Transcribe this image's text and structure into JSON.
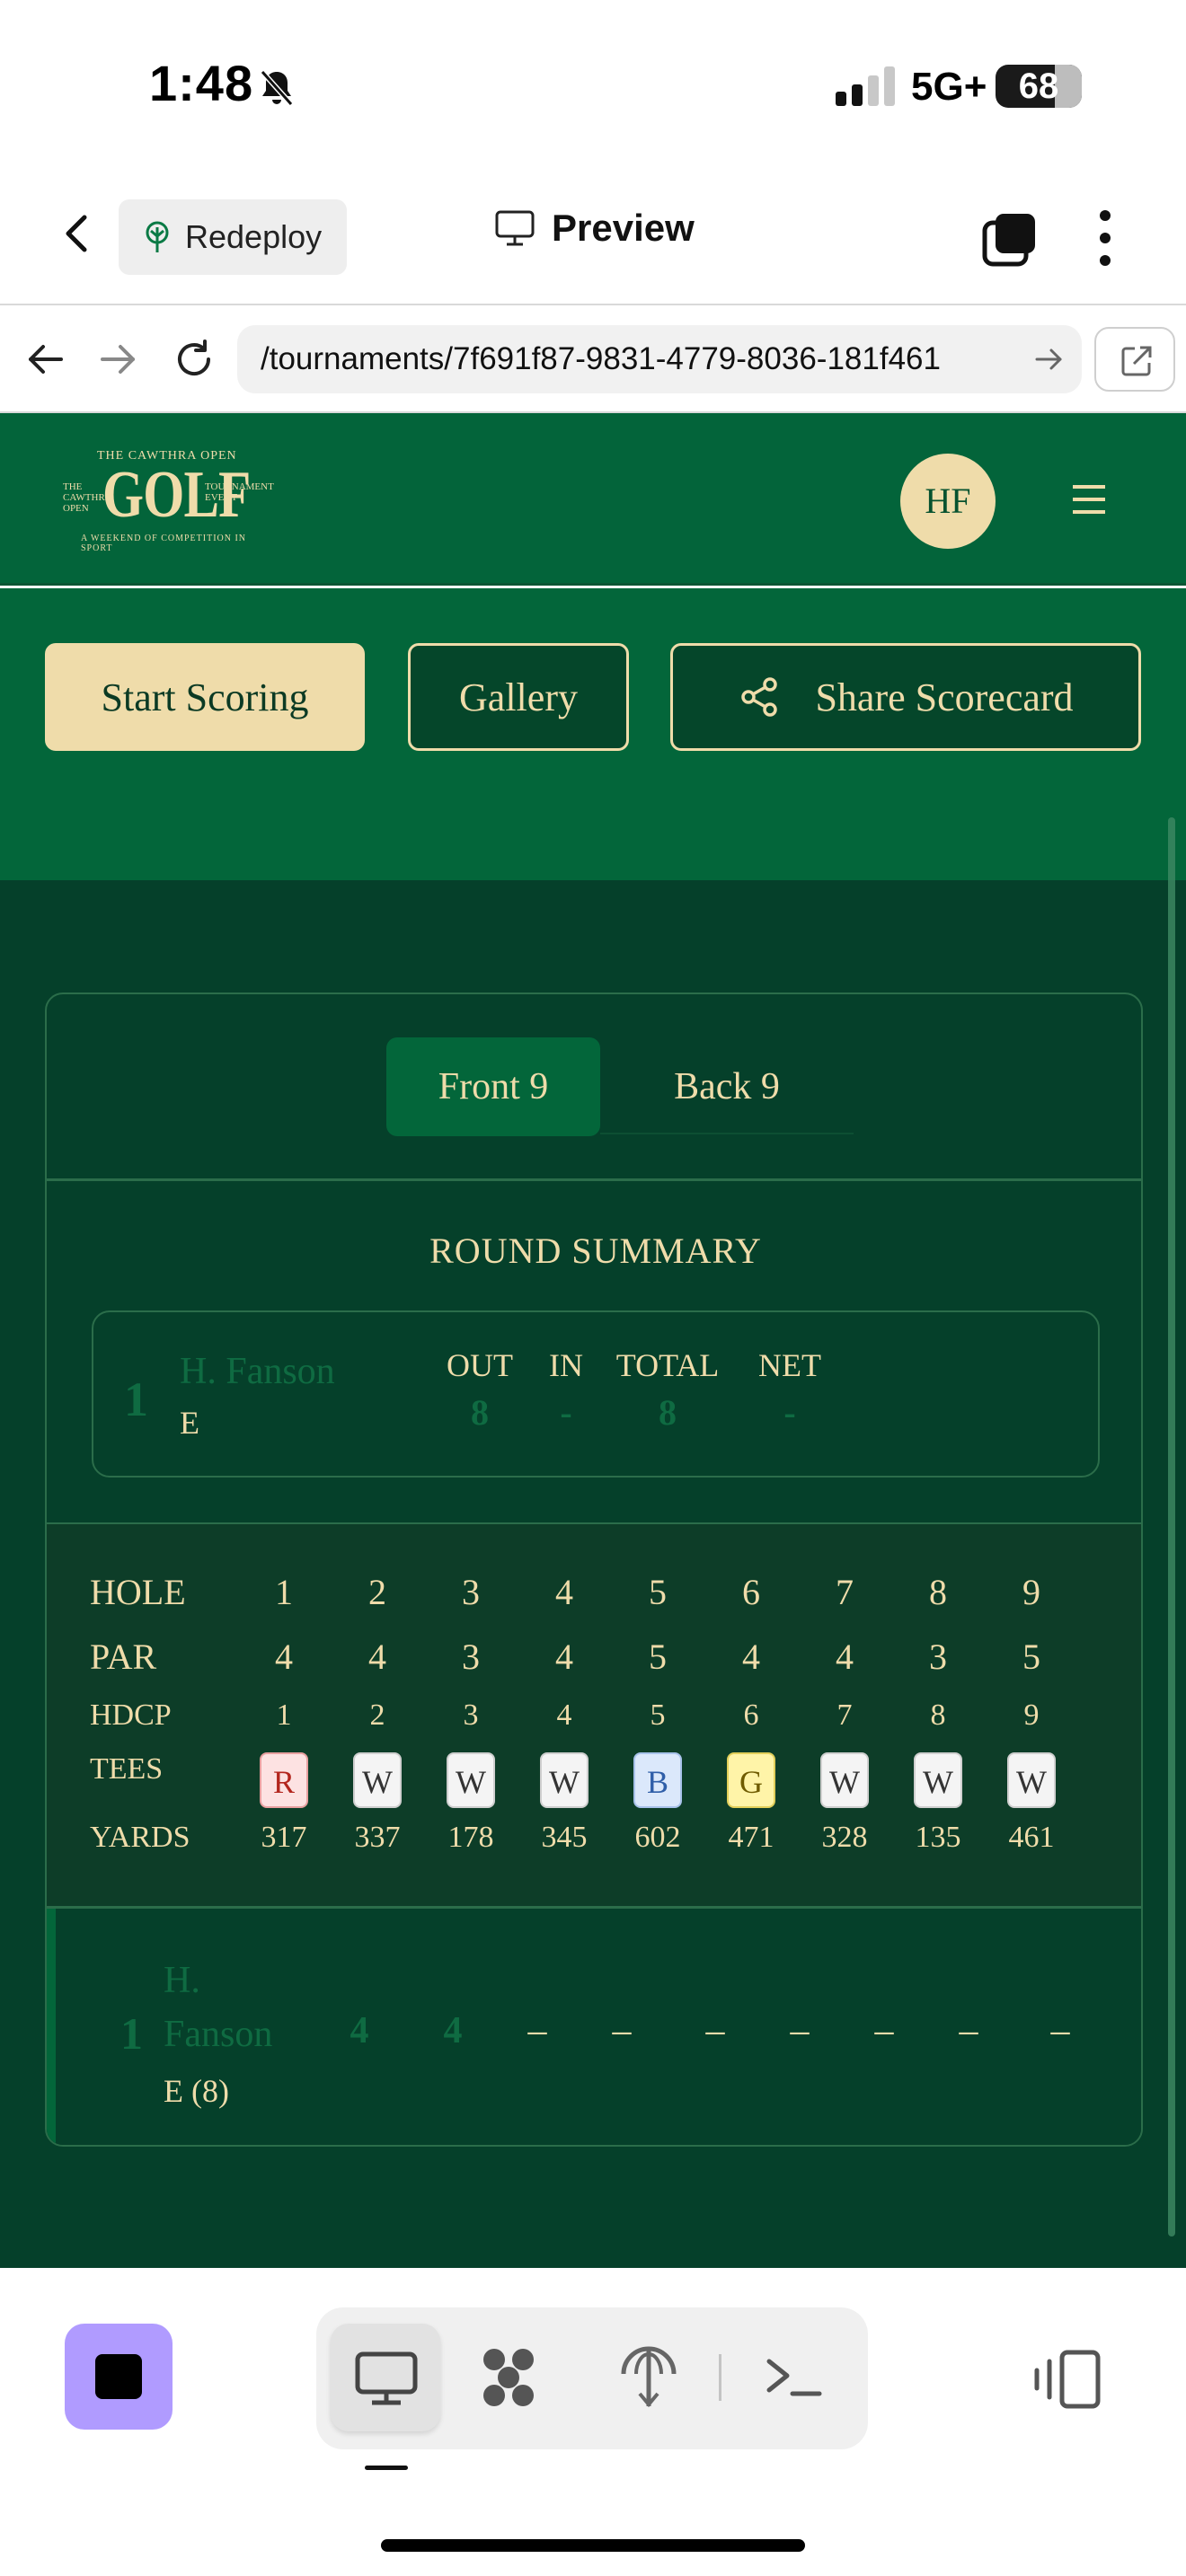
{
  "status_bar": {
    "time": "1:48",
    "network": "5G+",
    "battery": "68"
  },
  "app_bar": {
    "redeploy_label": "Redeploy",
    "preview_label": "Preview"
  },
  "url_bar": {
    "url": "/tournaments/7f691f87-9831-4779-8036-181f461"
  },
  "site": {
    "logo": {
      "top": "THE CAWTHRA OPEN",
      "main": "GOLF",
      "left": "THE CAWTHRA OPEN",
      "right": "TOURNAMENT EVENT",
      "bottom": "A WEEKEND OF COMPETITION IN SPORT"
    },
    "avatar_initials": "HF"
  },
  "actions": {
    "start_scoring": "Start Scoring",
    "gallery": "Gallery",
    "share_scorecard": "Share Scorecard"
  },
  "scorecard": {
    "tabs": {
      "front": "Front 9",
      "back": "Back 9",
      "selected": "Front 9"
    },
    "summary_title": "ROUND SUMMARY",
    "summary": {
      "rank": "1",
      "player": "H. Fanson",
      "to_par": "E",
      "headers": {
        "out": "OUT",
        "in": "IN",
        "total": "TOTAL",
        "net": "NET"
      },
      "values": {
        "out": "8",
        "in": "-",
        "total": "8",
        "net": "-"
      }
    },
    "labels": {
      "hole": "HOLE",
      "par": "PAR",
      "hdcp": "HDCP",
      "tees": "TEES",
      "yards": "YARDS"
    },
    "holes": [
      "1",
      "2",
      "3",
      "4",
      "5",
      "6",
      "7",
      "8",
      "9"
    ],
    "par": [
      "4",
      "4",
      "3",
      "4",
      "5",
      "4",
      "4",
      "3",
      "5"
    ],
    "hdcp": [
      "1",
      "2",
      "3",
      "4",
      "5",
      "6",
      "7",
      "8",
      "9"
    ],
    "tees": [
      "R",
      "W",
      "W",
      "W",
      "B",
      "G",
      "W",
      "W",
      "W"
    ],
    "tee_colors": {
      "R": {
        "bg": "#fde2e2",
        "fg": "#b3261e",
        "border": "#e8a0a0"
      },
      "W": {
        "bg": "#f4f4f4",
        "fg": "#333333",
        "border": "#cfcfcf"
      },
      "B": {
        "bg": "#dbe8fb",
        "fg": "#2f5ea8",
        "border": "#a8c2ea"
      },
      "G": {
        "bg": "#fff4a8",
        "fg": "#6f5b00",
        "border": "#e2cf5a"
      }
    },
    "yards": [
      "317",
      "337",
      "178",
      "345",
      "602",
      "471",
      "328",
      "135",
      "461"
    ],
    "player_row": {
      "rank": "1",
      "name_first": "H.",
      "name_last": "Fanson",
      "to_par_total": "E (8)",
      "scores": [
        "4",
        "4",
        "–",
        "–",
        "–",
        "–",
        "–",
        "–",
        "–"
      ]
    }
  },
  "colors": {
    "brand_green": "#03643a",
    "dark_green": "#05402a",
    "cream": "#efdcaa",
    "muted_green_text": "#0f6b42",
    "stop_button": "#b09bff"
  }
}
